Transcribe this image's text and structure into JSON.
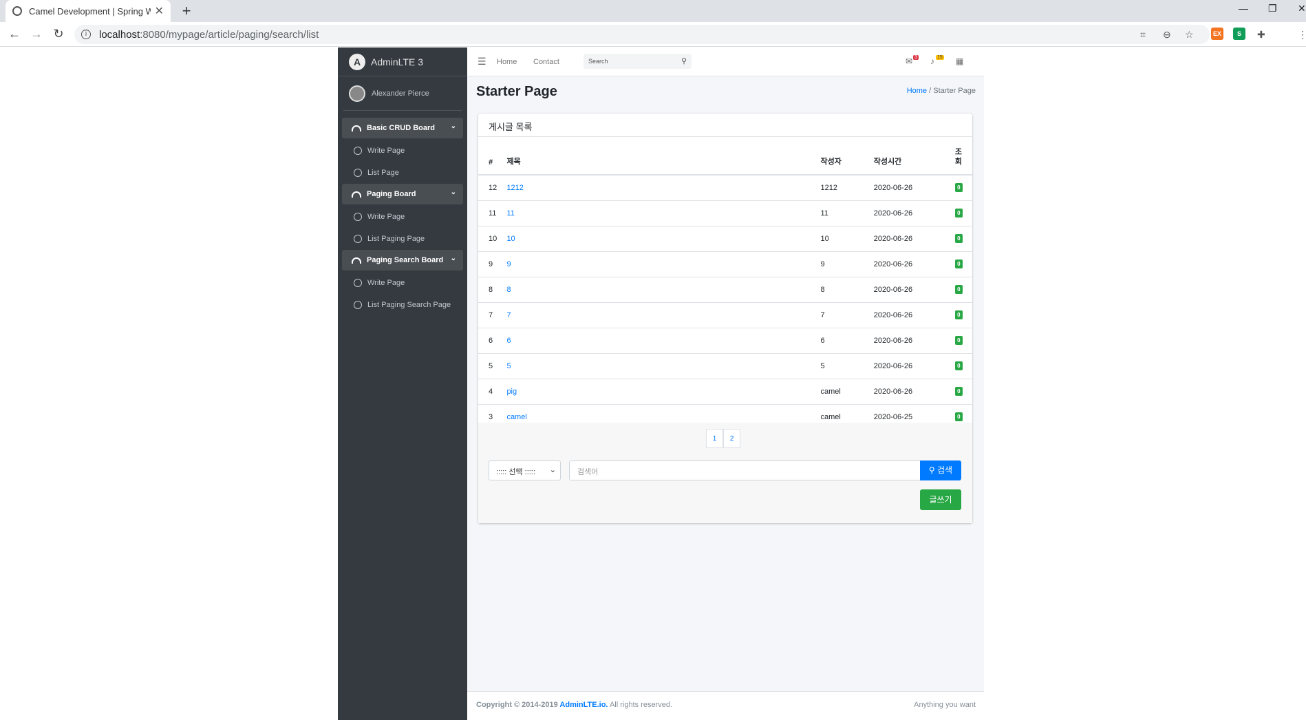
{
  "browser": {
    "tab_title": "Camel Development | Spring W",
    "url_host": "localhost",
    "url_path": ":8080/mypage/article/paging/search/list"
  },
  "brand": {
    "logo": "A",
    "name": "AdminLTE 3"
  },
  "user": {
    "name": "Alexander Pierce"
  },
  "sidebar": {
    "groups": [
      {
        "label": "Basic CRUD Board",
        "items": [
          "Write Page",
          "List Page"
        ]
      },
      {
        "label": "Paging Board",
        "items": [
          "Write Page",
          "List Paging Page"
        ]
      },
      {
        "label": "Paging Search Board",
        "items": [
          "Write Page",
          "List Paging Search Page"
        ]
      }
    ]
  },
  "topnav": {
    "home": "Home",
    "contact": "Contact",
    "search_placeholder": "Search",
    "messages_count": "3",
    "notifications_count": "15"
  },
  "header": {
    "title": "Starter Page",
    "breadcrumb_home": "Home",
    "breadcrumb_sep": "/",
    "breadcrumb_current": "Starter Page"
  },
  "card": {
    "title": "게시글 목록",
    "columns": [
      "#",
      "제목",
      "작성자",
      "작성시간",
      "조회"
    ],
    "rows": [
      {
        "no": "12",
        "title": "1212",
        "writer": "1212",
        "date": "2020-06-26",
        "views": "0"
      },
      {
        "no": "11",
        "title": "11",
        "writer": "11",
        "date": "2020-06-26",
        "views": "0"
      },
      {
        "no": "10",
        "title": "10",
        "writer": "10",
        "date": "2020-06-26",
        "views": "0"
      },
      {
        "no": "9",
        "title": "9",
        "writer": "9",
        "date": "2020-06-26",
        "views": "0"
      },
      {
        "no": "8",
        "title": "8",
        "writer": "8",
        "date": "2020-06-26",
        "views": "0"
      },
      {
        "no": "7",
        "title": "7",
        "writer": "7",
        "date": "2020-06-26",
        "views": "0"
      },
      {
        "no": "6",
        "title": "6",
        "writer": "6",
        "date": "2020-06-26",
        "views": "0"
      },
      {
        "no": "5",
        "title": "5",
        "writer": "5",
        "date": "2020-06-26",
        "views": "0"
      },
      {
        "no": "4",
        "title": "pig",
        "writer": "camel",
        "date": "2020-06-26",
        "views": "0"
      },
      {
        "no": "3",
        "title": "camel",
        "writer": "camel",
        "date": "2020-06-25",
        "views": "0"
      }
    ],
    "pages": [
      "1",
      "2"
    ],
    "search_type": "::::: 선택 :::::",
    "search_placeholder": "검색어",
    "search_button": "검색",
    "write_button": "글쓰기"
  },
  "footer": {
    "copyright": "Copyright © 2014-2019 ",
    "brand_link": "AdminLTE.io.",
    "rights": " All rights reserved.",
    "right_text": "Anything you want"
  },
  "colors": {
    "sidebar": "#343a40",
    "primary": "#007bff",
    "success": "#28a745",
    "danger": "#dc3545",
    "warning": "#ffc107"
  }
}
